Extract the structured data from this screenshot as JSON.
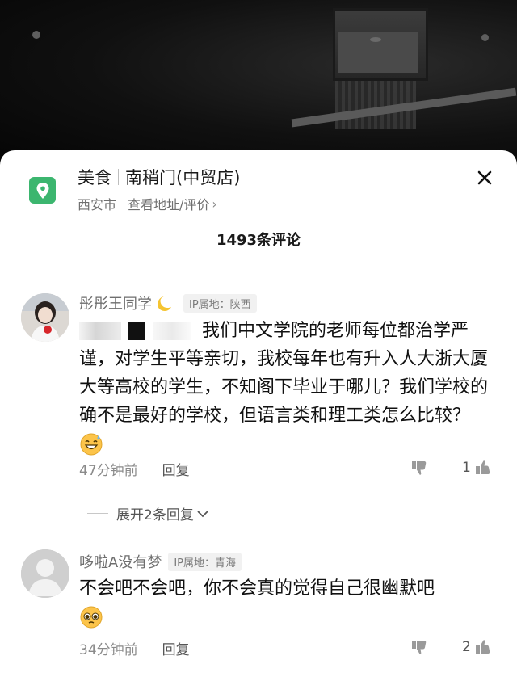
{
  "store": {
    "category": "美食",
    "name": "南稍门(中贸店)",
    "city": "西安市",
    "address_link": "查看地址/评价",
    "chevron": "›"
  },
  "comment_count": "1493条评论",
  "comments": [
    {
      "username": "彤彤王同学",
      "ip": "IP属地：陕西",
      "text": "我们中文学院的老师每位都治学严谨，对学生平等亲切，我校每年也有升入人大浙大厦大等高校的学生，不知阁下毕业于哪儿？我们学校的确不是最好的学校，但语言类和理工类怎么比较？",
      "time": "47分钟前",
      "reply_label": "回复",
      "likes": "1"
    },
    {
      "username": "哆啦A没有梦",
      "ip": "IP属地：青海",
      "text": "不会吧不会吧，你不会真的觉得自己很幽默吧",
      "time": "34分钟前",
      "reply_label": "回复",
      "likes": "2"
    }
  ],
  "expand_replies": "展开2条回复",
  "colors": {
    "accent_green": "#3cb66f",
    "meta_gray": "#8a8a8a"
  },
  "icons": [
    "location-pin-icon",
    "close-icon",
    "moon-icon",
    "sweat-smile-emoji-icon",
    "pleading-emoji-icon",
    "thumbs-down-icon",
    "thumbs-up-icon",
    "chevron-down-icon"
  ]
}
